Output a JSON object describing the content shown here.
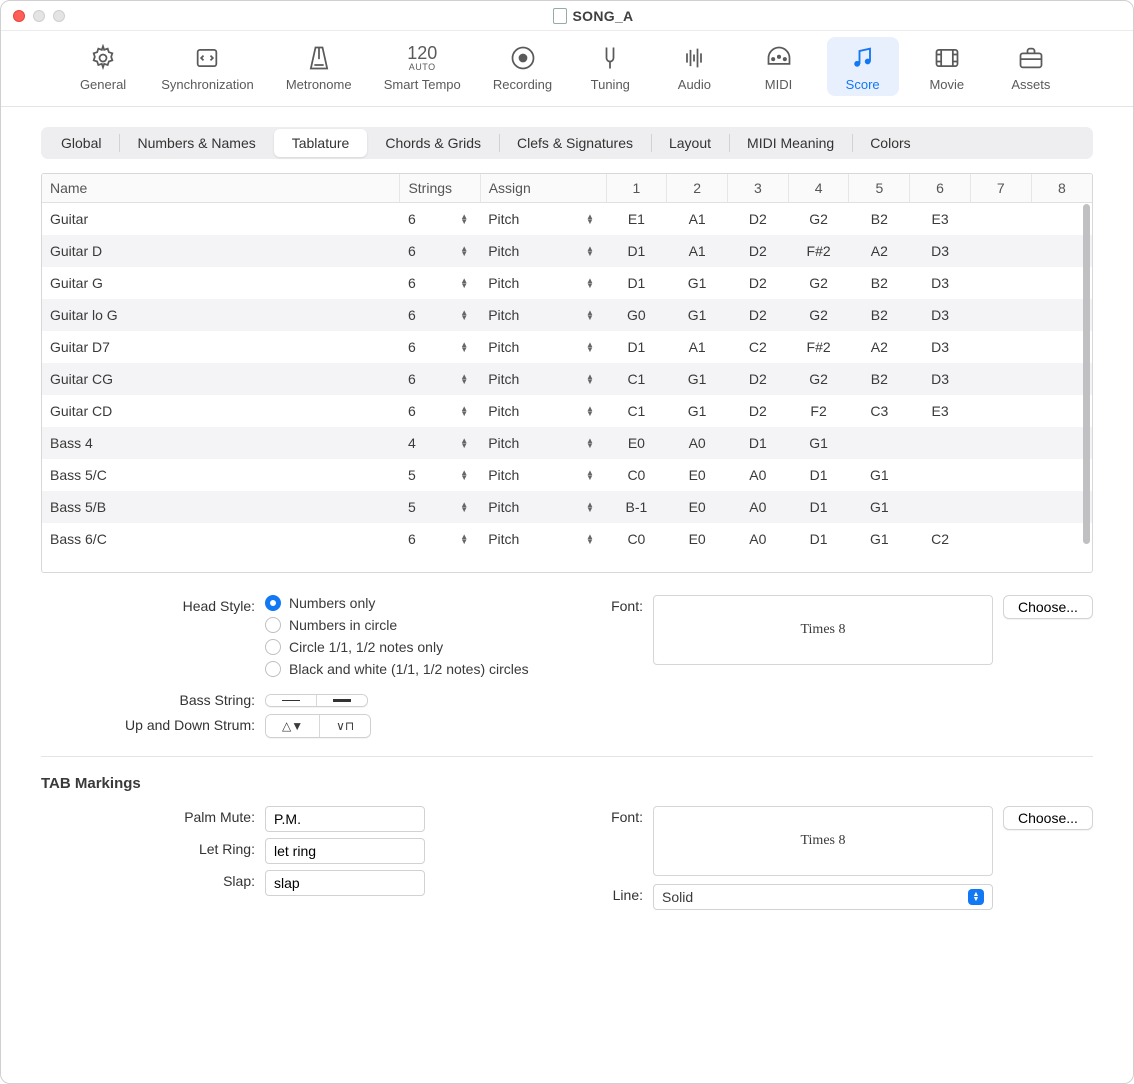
{
  "window": {
    "title": "SONG_A"
  },
  "toolbar": [
    {
      "id": "general",
      "label": "General"
    },
    {
      "id": "sync",
      "label": "Synchronization"
    },
    {
      "id": "metronome",
      "label": "Metronome"
    },
    {
      "id": "smarttempo",
      "label": "Smart Tempo"
    },
    {
      "id": "recording",
      "label": "Recording"
    },
    {
      "id": "tuning",
      "label": "Tuning"
    },
    {
      "id": "audio",
      "label": "Audio"
    },
    {
      "id": "midi",
      "label": "MIDI"
    },
    {
      "id": "score",
      "label": "Score",
      "active": true
    },
    {
      "id": "movie",
      "label": "Movie"
    },
    {
      "id": "assets",
      "label": "Assets"
    }
  ],
  "tempo": {
    "bpm": "120",
    "auto": "AUTO"
  },
  "subtabs": [
    "Global",
    "Numbers & Names",
    "Tablature",
    "Chords & Grids",
    "Clefs & Signatures",
    "Layout",
    "MIDI Meaning",
    "Colors"
  ],
  "subtab_active": "Tablature",
  "table": {
    "headers": [
      "Name",
      "Strings",
      "Assign",
      "1",
      "2",
      "3",
      "4",
      "5",
      "6",
      "7",
      "8"
    ],
    "rows": [
      {
        "name": "Guitar",
        "strings": "6",
        "assign": "Pitch",
        "n": [
          "E1",
          "A1",
          "D2",
          "G2",
          "B2",
          "E3",
          "",
          ""
        ]
      },
      {
        "name": "Guitar D",
        "strings": "6",
        "assign": "Pitch",
        "n": [
          "D1",
          "A1",
          "D2",
          "F#2",
          "A2",
          "D3",
          "",
          ""
        ]
      },
      {
        "name": "Guitar G",
        "strings": "6",
        "assign": "Pitch",
        "n": [
          "D1",
          "G1",
          "D2",
          "G2",
          "B2",
          "D3",
          "",
          ""
        ]
      },
      {
        "name": "Guitar lo G",
        "strings": "6",
        "assign": "Pitch",
        "n": [
          "G0",
          "G1",
          "D2",
          "G2",
          "B2",
          "D3",
          "",
          ""
        ]
      },
      {
        "name": "Guitar D7",
        "strings": "6",
        "assign": "Pitch",
        "n": [
          "D1",
          "A1",
          "C2",
          "F#2",
          "A2",
          "D3",
          "",
          ""
        ]
      },
      {
        "name": "Guitar CG",
        "strings": "6",
        "assign": "Pitch",
        "n": [
          "C1",
          "G1",
          "D2",
          "G2",
          "B2",
          "D3",
          "",
          ""
        ]
      },
      {
        "name": "Guitar CD",
        "strings": "6",
        "assign": "Pitch",
        "n": [
          "C1",
          "G1",
          "D2",
          "F2",
          "C3",
          "E3",
          "",
          ""
        ]
      },
      {
        "name": "Bass 4",
        "strings": "4",
        "assign": "Pitch",
        "n": [
          "E0",
          "A0",
          "D1",
          "G1",
          "",
          "",
          "",
          ""
        ]
      },
      {
        "name": "Bass 5/C",
        "strings": "5",
        "assign": "Pitch",
        "n": [
          "C0",
          "E0",
          "A0",
          "D1",
          "G1",
          "",
          "",
          ""
        ]
      },
      {
        "name": "Bass 5/B",
        "strings": "5",
        "assign": "Pitch",
        "n": [
          "B-1",
          "E0",
          "A0",
          "D1",
          "G1",
          "",
          "",
          ""
        ]
      },
      {
        "name": "Bass 6/C",
        "strings": "6",
        "assign": "Pitch",
        "n": [
          "C0",
          "E0",
          "A0",
          "D1",
          "G1",
          "C2",
          "",
          ""
        ]
      }
    ]
  },
  "head_style": {
    "label": "Head Style:",
    "options": [
      "Numbers only",
      "Numbers in circle",
      "Circle 1/1, 1/2 notes only",
      "Black and white (1/1, 1/2 notes) circles"
    ],
    "selected": 0
  },
  "bass_string": {
    "label": "Bass String:"
  },
  "strum": {
    "label": "Up and Down Strum:"
  },
  "font1": {
    "label": "Font:",
    "preview": "Times 8",
    "choose": "Choose..."
  },
  "tab_markings": {
    "heading": "TAB Markings",
    "palm_mute": {
      "label": "Palm Mute:",
      "value": "P.M."
    },
    "let_ring": {
      "label": "Let Ring:",
      "value": "let ring"
    },
    "slap": {
      "label": "Slap:",
      "value": "slap"
    },
    "font": {
      "label": "Font:",
      "preview": "Times 8",
      "choose": "Choose..."
    },
    "line": {
      "label": "Line:",
      "value": "Solid"
    }
  }
}
